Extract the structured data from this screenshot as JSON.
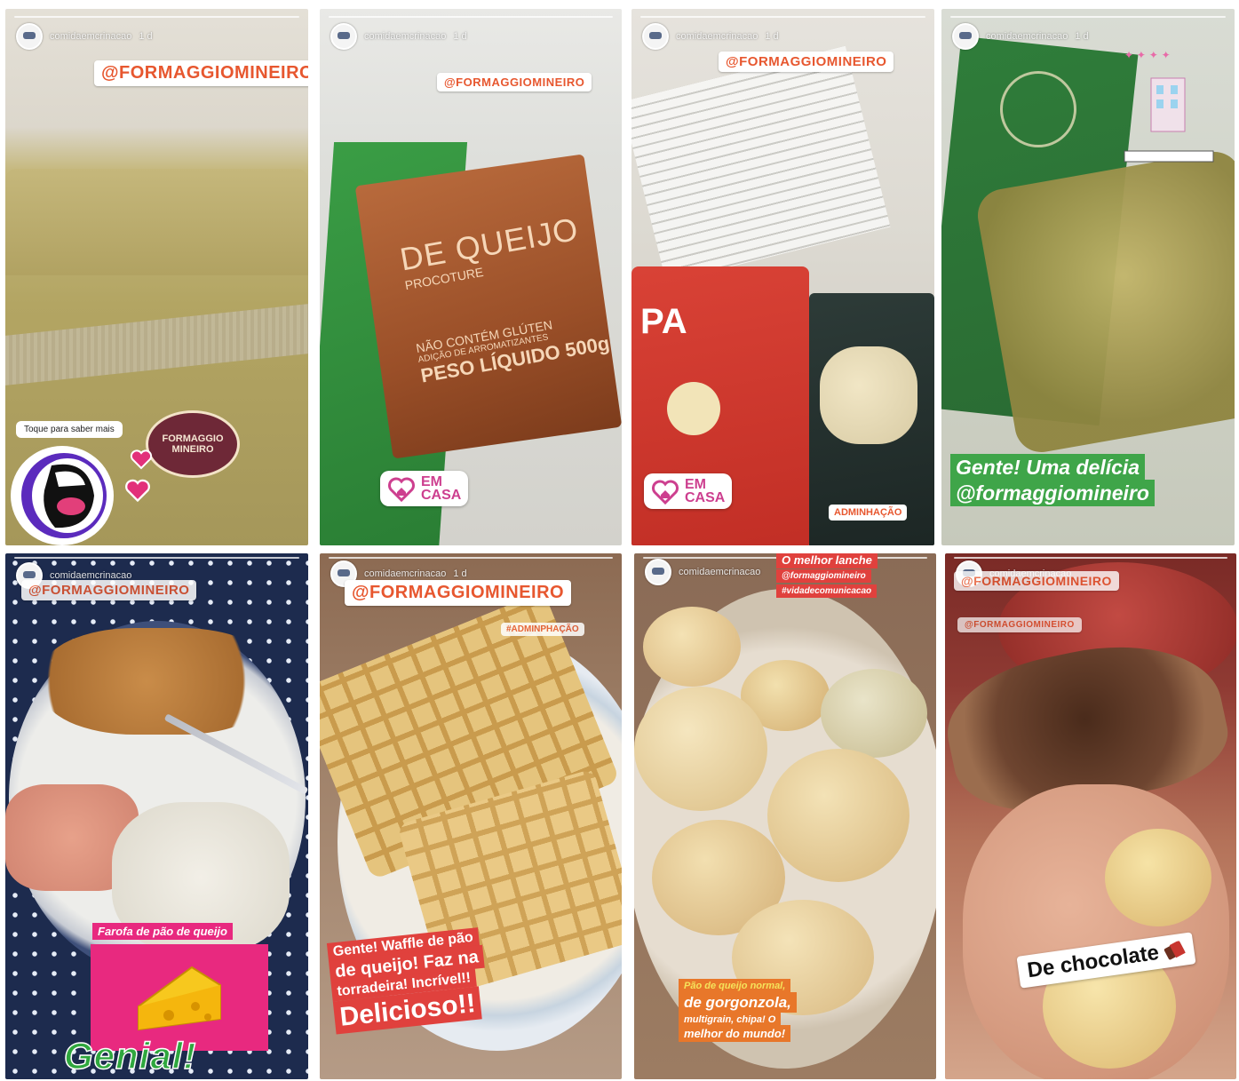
{
  "stories": [
    {
      "id": "1",
      "username": "comidaemcrinacao",
      "time": "1 d",
      "mention": "@FORMAGGIOMINEIRO",
      "tap_hint": "Toque para saber mais",
      "logo_text": "FORMAGGIO MINEIRO"
    },
    {
      "id": "2",
      "username": "comidaemcrinacao",
      "time": "1 d",
      "mention": "@FORMAGGIOMINEIRO",
      "package_line1": "DE QUEIJO",
      "package_line2": "PROCOTURE",
      "package_line3": "NÃO CONTÉM GLÚTEN",
      "package_line4": "ADIÇÃO DE ARROMATIZANTES",
      "package_line5": "PESO LÍQUIDO 500g",
      "sticker": "EM\nCASA"
    },
    {
      "id": "3",
      "username": "comidaemcrinacao",
      "time": "1 d",
      "mention": "@FORMAGGIOMINEIRO",
      "package_text": "PA",
      "sticker": "EM\nCASA",
      "tag": "ADMINHAÇÃO"
    },
    {
      "id": "4",
      "username": "comidaemcrinacao",
      "time": "1 d",
      "caption_line1": "Gente! Uma delícia",
      "caption_line2": "@formaggiomineiro"
    },
    {
      "id": "5",
      "username": "comidaemcrinacao",
      "mention": "@FORMAGGIOMINEIRO",
      "caption_small": "Farofa de pão de queijo",
      "caption_big": "Genial!"
    },
    {
      "id": "6",
      "username": "comidaemcrinacao",
      "time": "1 d",
      "mention": "@FORMAGGIOMINEIRO",
      "tag": "#ADMINPHAÇÃO",
      "caption_line1": "Gente! Waffle de pão",
      "caption_line2": "de queijo! Faz na",
      "caption_line3": "torradeira! Incrível!!",
      "caption_line4": "Delicioso!!"
    },
    {
      "id": "7",
      "username": "comidaemcrinacao",
      "caption_top1": "O melhor lanche",
      "caption_top2": "@formaggiomineiro",
      "caption_top3": "#vidadecomunicacao",
      "caption_bot1": "Pão de queijo normal,",
      "caption_bot2": "de gorgonzola,",
      "caption_bot3": "multigrain, chipa! O",
      "caption_bot4": "melhor do mundo!"
    },
    {
      "id": "8",
      "username": "comidaemcrinacao",
      "mention": "@FORMAGGIOMINEIRO",
      "mention2": "@FORMAGGIOMINEIRO",
      "caption": "De chocolate"
    }
  ],
  "colors": {
    "mention_text": "#e7572f",
    "caption_green": "#3fa549",
    "caption_red": "#e0413d",
    "caption_orange": "#e8772a",
    "caption_pink": "#e8297f",
    "sticker_pink": "#cd3f8f",
    "caption_yellow_text": "#f5e35b"
  },
  "icons": [
    "avatar",
    "open-mouth-icon",
    "heart-icon",
    "house-heart-icon",
    "cheese-icon",
    "chocolate-icon",
    "city-sticker-icon"
  ]
}
